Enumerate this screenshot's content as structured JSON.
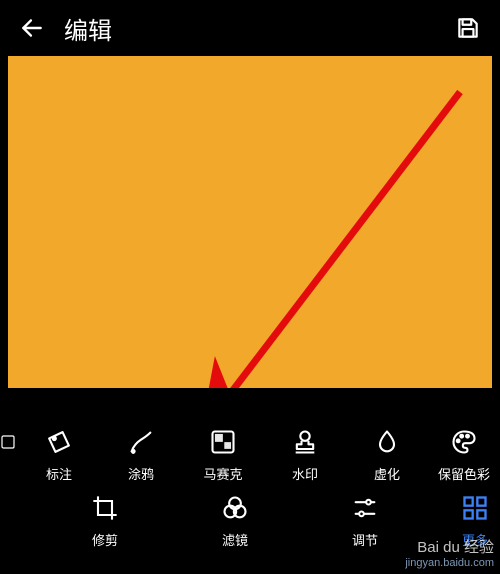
{
  "header": {
    "title": "编辑"
  },
  "canvas": {
    "bg": "#f2a82a",
    "arrow_color": "#e30b0b"
  },
  "tools": {
    "annotate": "标注",
    "doodle": "涂鸦",
    "mosaic": "马赛克",
    "watermark": "水印",
    "blur": "虚化",
    "retaincolor": "保留色彩"
  },
  "bottom": {
    "crop": "修剪",
    "filter": "滤镜",
    "adjust": "调节",
    "more": "更多"
  },
  "footer_watermark": {
    "brand": "Bai du 经验",
    "url": "jingyan.baidu.com"
  }
}
